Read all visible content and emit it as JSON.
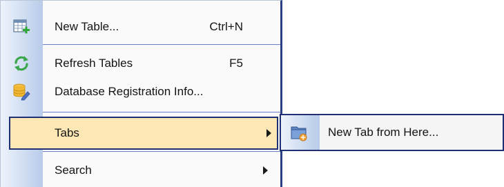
{
  "context_menu": {
    "items": [
      {
        "label": "New Table...",
        "shortcut": "Ctrl+N",
        "icon": "new-table-icon"
      },
      {
        "label": "Refresh Tables",
        "shortcut": "F5",
        "icon": "refresh-icon"
      },
      {
        "label": "Database Registration Info...",
        "shortcut": "",
        "icon": "database-edit-icon"
      },
      {
        "label": "Tabs",
        "shortcut": "",
        "has_submenu": true,
        "highlighted": true
      },
      {
        "label": "Search",
        "shortcut": "",
        "has_submenu": true
      }
    ]
  },
  "submenu": {
    "items": [
      {
        "label": "New Tab from Here...",
        "icon": "new-tab-folder-icon"
      }
    ]
  },
  "colors": {
    "highlight_fill": "#fde7b4",
    "highlight_border": "#1f2f73",
    "gutter": "#c9d8ef"
  }
}
